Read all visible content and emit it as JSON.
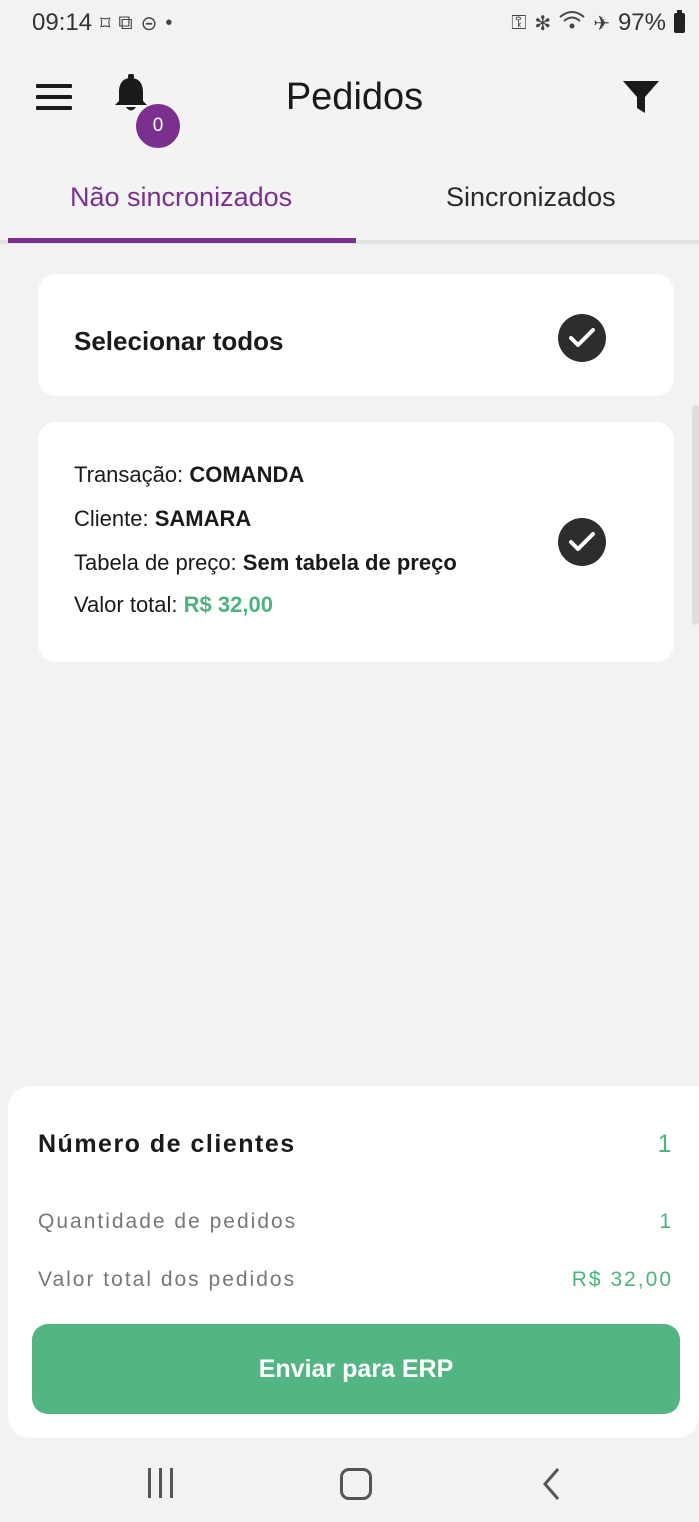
{
  "status_bar": {
    "time": "09:14",
    "left_icons": [
      "screenshot-icon",
      "cast-icon",
      "do-not-disturb-icon"
    ],
    "dot": "•",
    "right_icons": [
      "vpn-key-icon",
      "bluetooth-icon",
      "wifi-icon",
      "airplane-icon"
    ],
    "battery": "97%"
  },
  "app_bar": {
    "title": "Pedidos",
    "notification_count": "0"
  },
  "tabs": [
    {
      "label": "Não sincronizados",
      "active": true
    },
    {
      "label": "Sincronizados",
      "active": false
    }
  ],
  "select_all": {
    "label": "Selecionar todos",
    "checked": true
  },
  "order": {
    "transacao_label": "Transação: ",
    "transacao_value": "COMANDA",
    "cliente_label": "Cliente: ",
    "cliente_value": "SAMARA",
    "tabela_label": "Tabela de preço: ",
    "tabela_value": "Sem tabela de preço",
    "valor_label": "Valor total: ",
    "valor_value": "R$ 32,00",
    "checked": true
  },
  "summary": {
    "clientes_label": "Número de clientes",
    "clientes_value": "1",
    "pedidos_label": "Quantidade de pedidos",
    "pedidos_value": "1",
    "valor_label": "Valor total dos pedidos",
    "valor_value": "R$ 32,00",
    "send_button": "Enviar para ERP"
  },
  "colors": {
    "accent_purple": "#7b2f8f",
    "green": "#52b583",
    "value_green": "#4cb37f"
  }
}
